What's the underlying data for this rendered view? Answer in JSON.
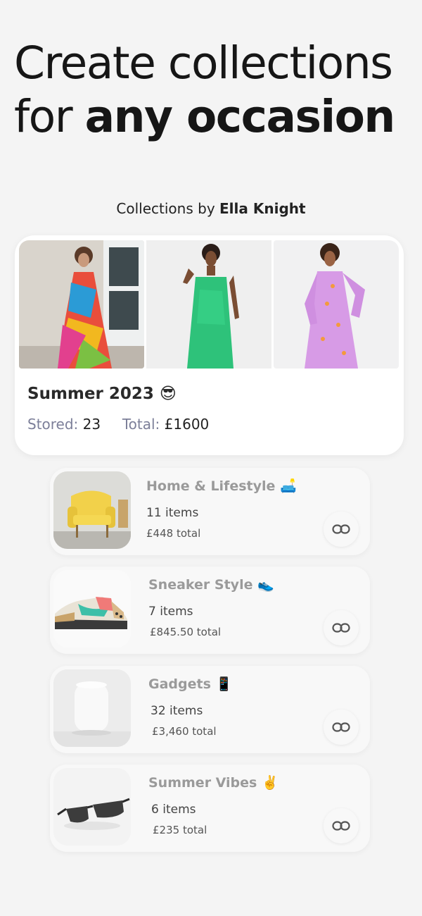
{
  "headline": {
    "line1": "Create collections",
    "line2_regular": "for ",
    "line2_bold": "any occasion"
  },
  "byline": {
    "prefix": "Collections by ",
    "author": "Ella Knight"
  },
  "featured": {
    "title": "Summer 2023 😎",
    "stored_label": "Stored:",
    "stored_value": "23",
    "total_label": "Total:",
    "total_value": "£1600",
    "photos": [
      "colorful-wrap-dress-photo",
      "green-slip-dress-photo",
      "pink-maxi-dress-photo"
    ]
  },
  "collections": [
    {
      "title": "Home & Lifestyle 🛋️",
      "count": "11 items",
      "total": "£448 total",
      "thumb_icon": "yellow-armchair-thumb"
    },
    {
      "title": "Sneaker Style 👟",
      "count": "7 items",
      "total": "£845.50 total",
      "thumb_icon": "sneaker-thumb"
    },
    {
      "title": "Gadgets 📱",
      "count": "32 items",
      "total": "£3,460 total",
      "thumb_icon": "smart-speaker-thumb"
    },
    {
      "title": "Summer Vibes ✌️",
      "count": "6 items",
      "total": "£235 total",
      "thumb_icon": "sunglasses-thumb"
    }
  ],
  "colors": {
    "background": "#f4f4f4",
    "card": "#ffffff",
    "stat_label": "#7c7f99",
    "muted_title": "#9a9a9a"
  }
}
